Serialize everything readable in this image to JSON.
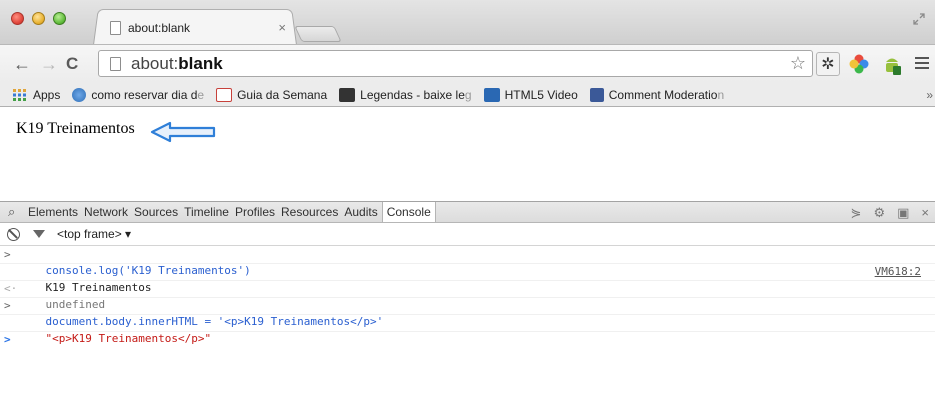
{
  "window": {
    "tab_title": "about:blank",
    "tab_close": "×"
  },
  "toolbar": {
    "back": "←",
    "forward": "→",
    "reload": "C",
    "url_prefix": "about:",
    "url_bold": "blank",
    "star": "☆",
    "gear": "✲"
  },
  "bookmarks": [
    {
      "label": "Apps",
      "icon": "apps-grid-icon",
      "color": "#3a7bd5"
    },
    {
      "label": "como reservar dia d",
      "fade": "e",
      "icon": "globe-icon",
      "color": "#2f6fb7"
    },
    {
      "label": "Guia da Semana",
      "icon": "guia-icon",
      "color": "#c7413b"
    },
    {
      "label": "Legendas - baixe le",
      "fade": "g",
      "icon": "legendas-icon",
      "color": "#333333"
    },
    {
      "label": "HTML5 Video",
      "icon": "w3-icon",
      "color": "#2a68b3"
    },
    {
      "label": "Comment Moderatio",
      "fade": "n",
      "icon": "facebook-icon",
      "color": "#3b5998"
    }
  ],
  "bookmarks_overflow": "»",
  "page": {
    "text": "K19 Treinamentos"
  },
  "devtools": {
    "tabs": [
      "Elements",
      "Network",
      "Sources",
      "Timeline",
      "Profiles",
      "Resources",
      "Audits",
      "Console"
    ],
    "selected_tab": "Console",
    "frame_selector": "<top frame> ▾",
    "console_lines": [
      {
        "type": "input",
        "prompt": ">",
        "text": "console.log('K19 Treinamentos')"
      },
      {
        "type": "log",
        "prompt": "",
        "text": "K19 Treinamentos",
        "source": "VM618:2"
      },
      {
        "type": "result",
        "prompt": "<·",
        "text": "undefined"
      },
      {
        "type": "input",
        "prompt": ">",
        "text": "document.body.innerHTML = '<p>K19 Treinamentos</p>'"
      },
      {
        "type": "string",
        "prompt": "",
        "text": "\"<p>K19 Treinamentos</p>\""
      },
      {
        "type": "caret",
        "prompt": ">",
        "text": ""
      }
    ]
  },
  "colors": {
    "arrow": "#2f7fd8",
    "console_input": "#2a5fd0",
    "console_string": "#c41a16"
  }
}
